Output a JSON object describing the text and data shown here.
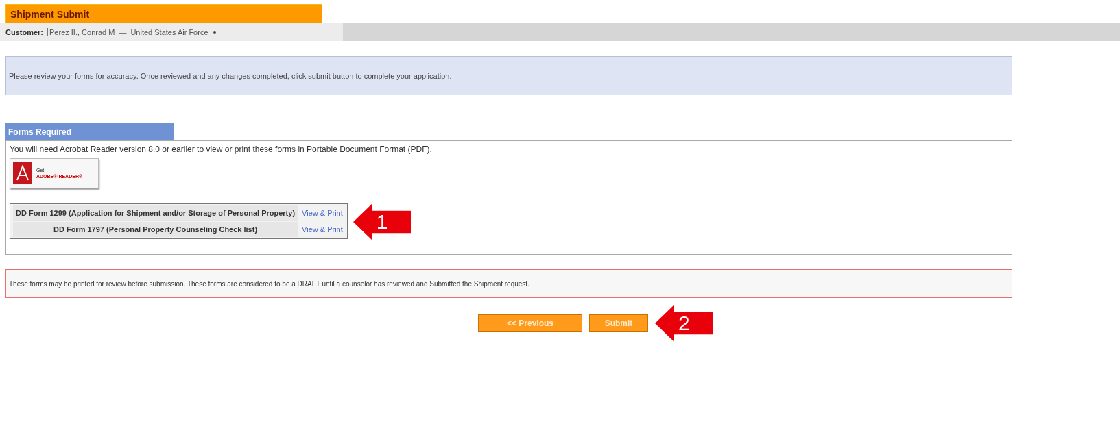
{
  "title": "Shipment Submit",
  "customer": {
    "label": "Customer:",
    "name": "Perez II., Conrad M",
    "separator": "—",
    "branch": "United States Air Force"
  },
  "instructions": "Please review your forms for accuracy. Once reviewed and any changes completed, click submit button to complete your application.",
  "forms_section": {
    "header": "Forms Required",
    "note": "You will need Acrobat Reader version 8.0 or earlier to view or print these forms in Portable Document Format (PDF).",
    "reader_badge": {
      "line1": "Get",
      "line2": "ADOBE® READER®"
    },
    "forms": [
      {
        "name": "DD Form 1299 (Application for Shipment and/or Storage of Personal Property)",
        "link": "View & Print"
      },
      {
        "name": "DD Form 1797 (Personal Property Counseling Check list)",
        "link": "View & Print"
      }
    ]
  },
  "notice": "These forms may be printed for review before submission. These forms are considered to be a DRAFT until a counselor has reviewed and Submitted the Shipment request.",
  "buttons": [
    {
      "label": "<< Previous"
    },
    {
      "label": "Submit"
    }
  ],
  "callouts": [
    {
      "number": "1"
    },
    {
      "number": "2"
    }
  ]
}
